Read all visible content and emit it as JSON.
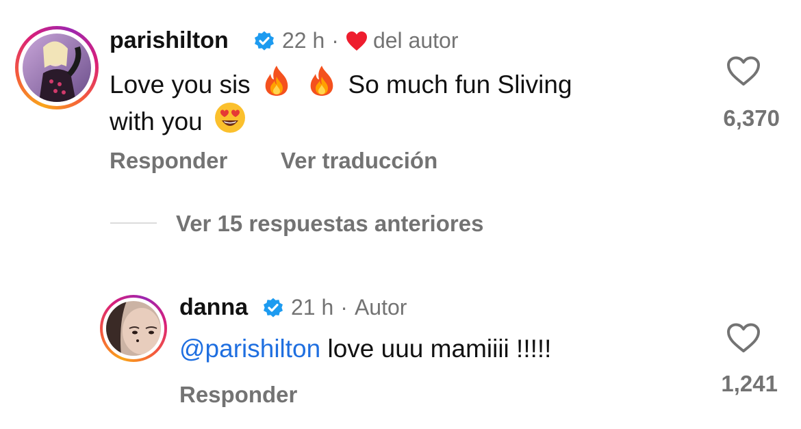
{
  "comments": [
    {
      "username": "parishilton",
      "time": "22 h",
      "separator": "·",
      "liked_label": "del autor",
      "text_part1": "Love you sis",
      "text_part2": "So much fun Sliving",
      "text_line2": "with you",
      "likes": "6,370",
      "reply_label": "Responder",
      "translate_label": "Ver traducción"
    },
    {
      "username": "danna",
      "time": "21 h",
      "separator": "·",
      "author_label": "Autor",
      "mention": "@parishilton",
      "text": "love uuu mamiiii !!!!!",
      "likes": "1,241",
      "reply_label": "Responder"
    }
  ],
  "view_replies_label": "Ver 15 respuestas anteriores",
  "colors": {
    "verified": "#1d9bf0",
    "heart": "#ee1d2e",
    "mention": "#1f6fe0",
    "muted": "#737373"
  },
  "icons": [
    "verified-badge-icon",
    "heart-filled-icon",
    "heart-outline-icon",
    "fire-emoji",
    "heart-eyes-emoji"
  ]
}
